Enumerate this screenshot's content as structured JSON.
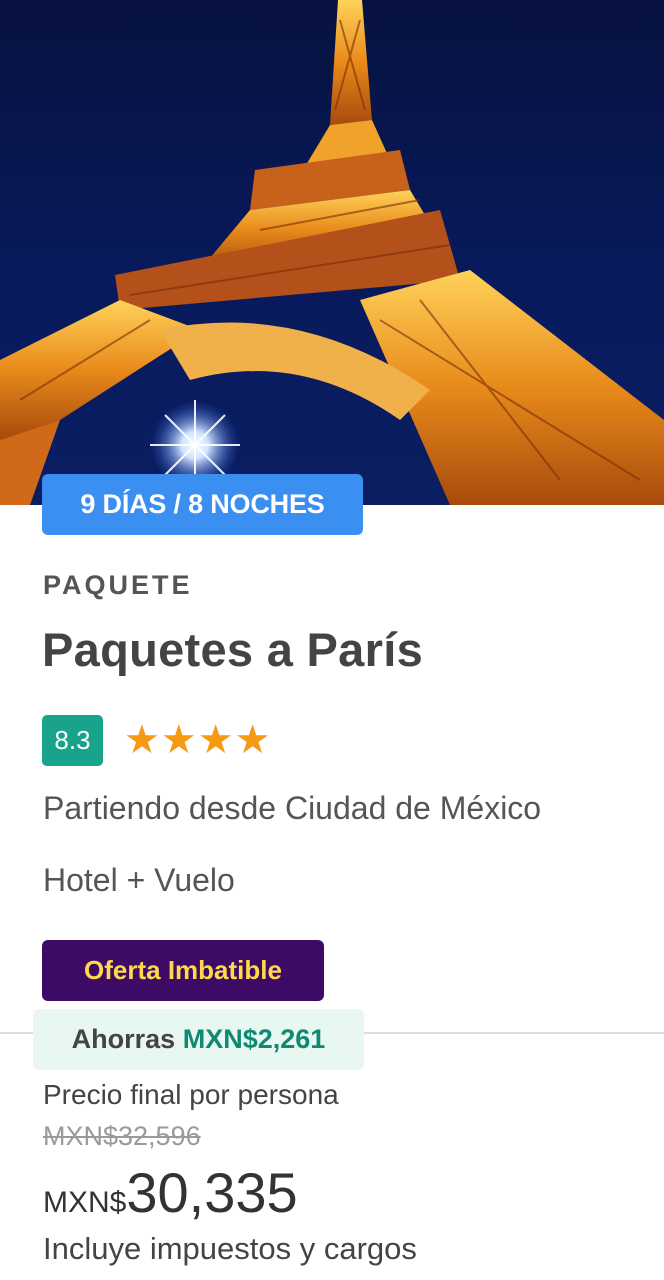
{
  "card": {
    "duration_badge": "9 DÍAS / 8 NOCHES",
    "type_label": "PAQUETE",
    "title": "Paquetes a París",
    "rating": "8.3",
    "stars": "★★★★",
    "star_count": 4,
    "origin": "Partiendo desde Ciudad de México",
    "product": "Hotel + Vuelo",
    "offer_tag": "Oferta Imbatible",
    "savings_label": "Ahorras",
    "savings_amount": "MXN$2,261",
    "price_label": "Precio final por persona",
    "old_price": "MXN$32,596",
    "currency": "MXN$",
    "final_price": "30,335",
    "taxes_note": "Incluye impuestos y cargos"
  },
  "colors": {
    "badge_blue": "#3b8ff0",
    "rating_green": "#1aa38b",
    "star_orange": "#f59a12",
    "offer_purple": "#3d0b66",
    "offer_yellow": "#ffd94a",
    "savings_bg": "#e8f7f0",
    "savings_green": "#0f8a72"
  },
  "hero_image": "eiffel-tower-night-photo"
}
